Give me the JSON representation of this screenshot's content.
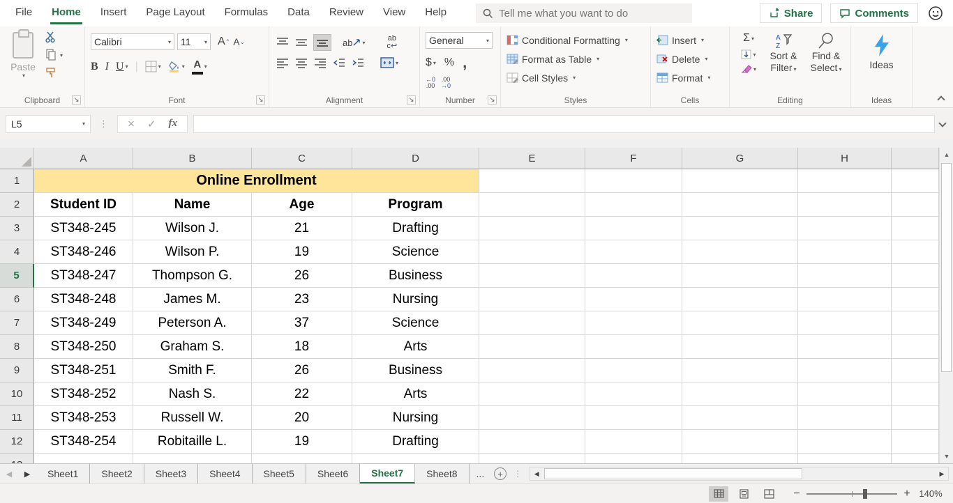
{
  "colors": {
    "excel_green": "#217346",
    "title_fill": "#ffe59a",
    "icon_blue": "#2b579a",
    "ideas_blue": "#3aa3e8"
  },
  "menu": {
    "tabs": [
      {
        "label": "File"
      },
      {
        "label": "Home"
      },
      {
        "label": "Insert"
      },
      {
        "label": "Page Layout"
      },
      {
        "label": "Formulas"
      },
      {
        "label": "Data"
      },
      {
        "label": "Review"
      },
      {
        "label": "View"
      },
      {
        "label": "Help"
      }
    ],
    "active_tab": "Home",
    "search_placeholder": "Tell me what you want to do",
    "share_label": "Share",
    "comments_label": "Comments"
  },
  "ribbon": {
    "clipboard": {
      "label": "Clipboard",
      "paste": "Paste"
    },
    "font": {
      "label": "Font",
      "font_name": "Calibri",
      "font_size": "11"
    },
    "alignment": {
      "label": "Alignment"
    },
    "number": {
      "label": "Number",
      "format": "General"
    },
    "styles": {
      "label": "Styles",
      "conditional_formatting": "Conditional Formatting",
      "format_as_table": "Format as Table",
      "cell_styles": "Cell Styles"
    },
    "cells": {
      "label": "Cells",
      "insert": "Insert",
      "delete": "Delete",
      "format": "Format"
    },
    "editing": {
      "label": "Editing",
      "sort_line1": "Sort &",
      "sort_line2": "Filter",
      "find_line1": "Find &",
      "find_line2": "Select"
    },
    "ideas": {
      "label": "Ideas",
      "button": "Ideas"
    }
  },
  "icons": {
    "bold": "B",
    "italic": "I",
    "underline": "U",
    "sum": "Σ",
    "dollar": "$",
    "percent": "%",
    "comma": ",",
    "orientation_text": "ab",
    "wrap_top": "ab",
    "wrap_bottom": "c",
    "inc_dec_top": "←0",
    "inc_dec_bottom": ".00",
    "dec_dec_top": ".00",
    "dec_dec_bottom": "→0",
    "cancel": "×",
    "enter": "✓",
    "fx": "fx",
    "name_box_arrow": "▾",
    "dots_vertical": "⋮",
    "up_arrow": "▲",
    "down_arrow": "▼",
    "left_arrow": "◀",
    "right_arrow": "▶",
    "font_grow": "A",
    "font_shrink": "A"
  },
  "formula_bar": {
    "name_box": "L5",
    "formula": ""
  },
  "sheet": {
    "columns": [
      "A",
      "B",
      "C",
      "D",
      "E",
      "F",
      "G",
      "H"
    ],
    "title": "Online Enrollment",
    "headers": [
      "Student ID",
      "Name",
      "Age",
      "Program"
    ],
    "rows": [
      [
        "ST348-245",
        "Wilson J.",
        "21",
        "Drafting"
      ],
      [
        "ST348-246",
        "Wilson P.",
        "19",
        "Science"
      ],
      [
        "ST348-247",
        "Thompson G.",
        "26",
        "Business"
      ],
      [
        "ST348-248",
        "James M.",
        "23",
        "Nursing"
      ],
      [
        "ST348-249",
        "Peterson A.",
        "37",
        "Science"
      ],
      [
        "ST348-250",
        "Graham S.",
        "18",
        "Arts"
      ],
      [
        "ST348-251",
        "Smith F.",
        "26",
        "Business"
      ],
      [
        "ST348-252",
        "Nash S.",
        "22",
        "Arts"
      ],
      [
        "ST348-253",
        "Russell W.",
        "20",
        "Nursing"
      ],
      [
        "ST348-254",
        "Robitaille L.",
        "19",
        "Drafting"
      ]
    ],
    "active_row": 5,
    "visible_rows": 13
  },
  "tabs": {
    "sheets": [
      "Sheet1",
      "Sheet2",
      "Sheet3",
      "Sheet4",
      "Sheet5",
      "Sheet6",
      "Sheet7",
      "Sheet8"
    ],
    "active": "Sheet7",
    "overflow": "..."
  },
  "status": {
    "zoom": "140%"
  }
}
